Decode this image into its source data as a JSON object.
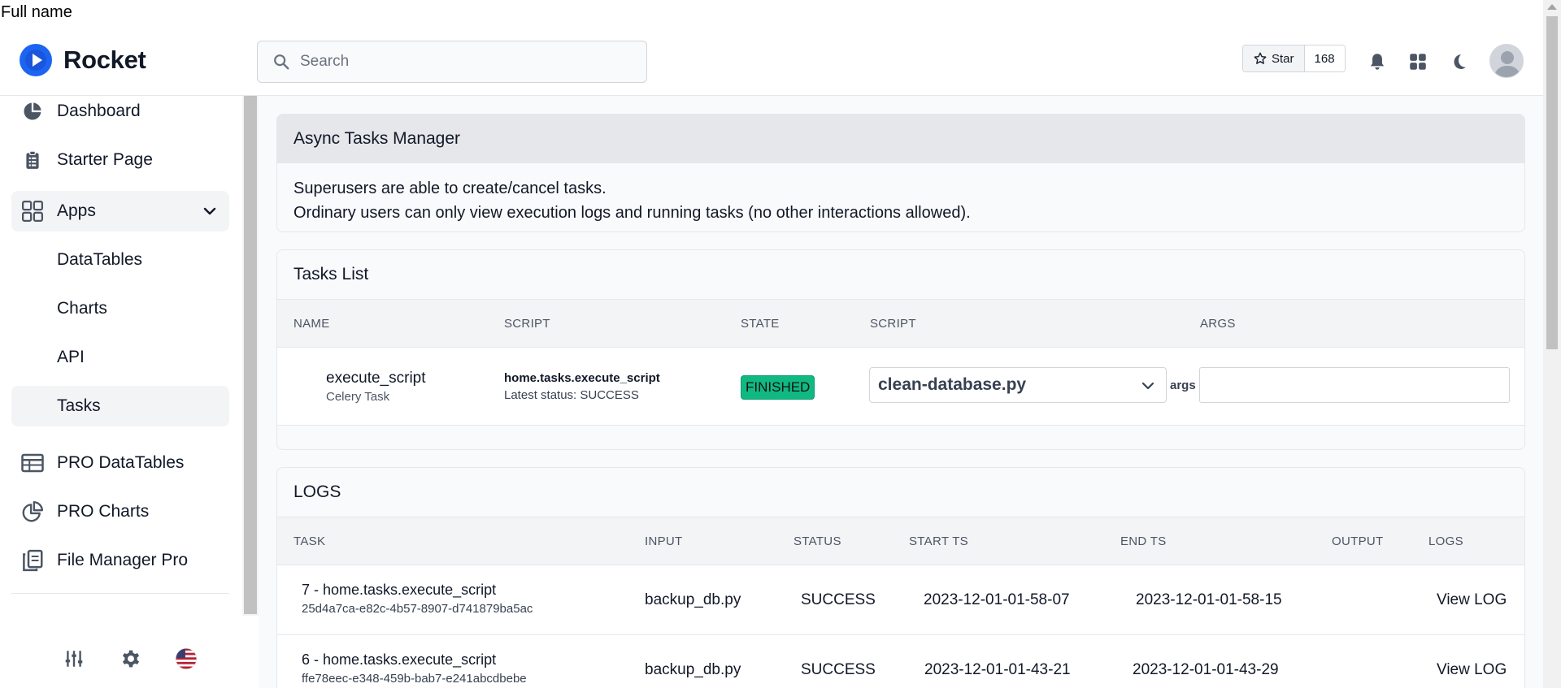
{
  "overlay": {
    "full_name_label": "Full name"
  },
  "header": {
    "brand": "Rocket",
    "search_placeholder": "Search",
    "star_label": "Star",
    "star_count": "168"
  },
  "sidebar": {
    "items": [
      {
        "label": "Dashboard",
        "icon": "pie-chart-icon"
      },
      {
        "label": "Starter Page",
        "icon": "clipboard-icon"
      },
      {
        "label": "Apps",
        "icon": "grid-icon",
        "expanded": true
      },
      {
        "label": "DataTables"
      },
      {
        "label": "Charts"
      },
      {
        "label": "API"
      },
      {
        "label": "Tasks",
        "active": true
      },
      {
        "label": "PRO DataTables",
        "icon": "table-icon"
      },
      {
        "label": "PRO Charts",
        "icon": "chart-pie-outline-icon"
      },
      {
        "label": "File Manager Pro",
        "icon": "files-icon"
      }
    ],
    "tools": [
      "sliders-icon",
      "gear-icon",
      "us-flag-icon"
    ]
  },
  "info_card": {
    "title": "Async Tasks Manager",
    "line1": "Superusers are able to create/cancel tasks.",
    "line2": "Ordinary users can only view execution logs and running tasks (no other interactions allowed)."
  },
  "tasks_card": {
    "title": "Tasks List",
    "columns": [
      "NAME",
      "SCRIPT",
      "STATE",
      "SCRIPT",
      "ARGS"
    ],
    "row": {
      "name": "execute_script",
      "type": "Celery Task",
      "script": "home.tasks.execute_script",
      "latest_status": "Latest status: SUCCESS",
      "state": "FINISHED",
      "selected_script": "clean-database.py",
      "args_label": "args",
      "args_value": ""
    }
  },
  "logs_card": {
    "title": "LOGS",
    "columns": [
      "TASK",
      "INPUT",
      "STATUS",
      "START TS",
      "END TS",
      "OUTPUT",
      "LOGS"
    ],
    "rows": [
      {
        "task": "7 - home.tasks.execute_script",
        "id": "25d4a7ca-e82c-4b57-8907-d741879ba5ac",
        "input": "backup_db.py",
        "status": "SUCCESS",
        "start": "2023-12-01-01-58-07",
        "end": "2023-12-01-01-58-15",
        "output": "",
        "log": "View LOG"
      },
      {
        "task": "6 - home.tasks.execute_script",
        "id": "ffe78eec-e348-459b-bab7-e241abcdbebe",
        "input": "backup_db.py",
        "status": "SUCCESS",
        "start": "2023-12-01-01-43-21",
        "end": "2023-12-01-01-43-29",
        "output": "",
        "log": "View LOG"
      }
    ]
  },
  "colors": {
    "accent": "#1c64f2",
    "finished_badge": "#10b981",
    "card_header": "#e5e7eb"
  }
}
